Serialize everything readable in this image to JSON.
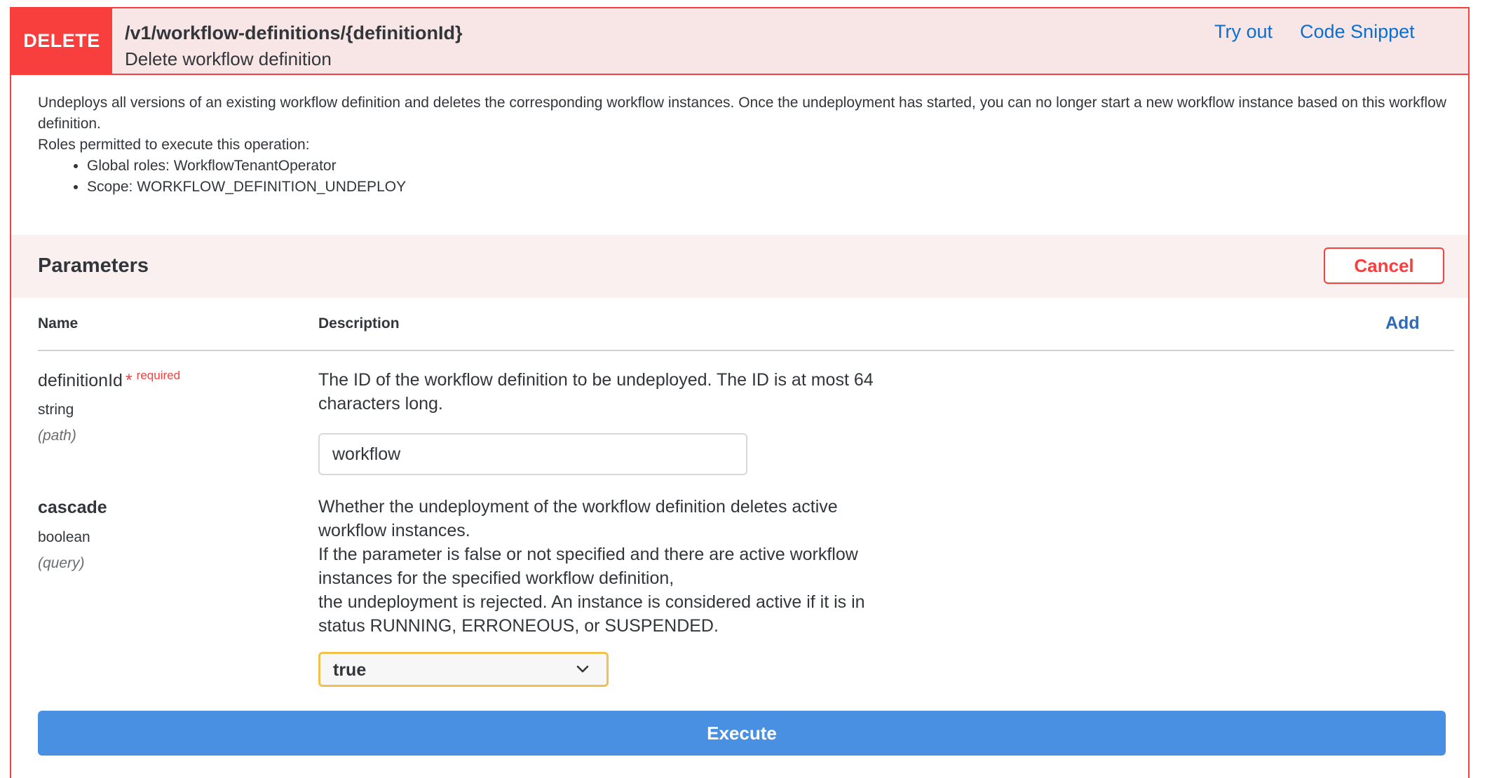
{
  "operation": {
    "method": "DELETE",
    "path": "/v1/workflow-definitions/{definitionId}",
    "summary": "Delete workflow definition",
    "links": {
      "try_out": "Try out",
      "code_snippet": "Code Snippet"
    },
    "description": "Undeploys all versions of an existing workflow definition and deletes the corresponding workflow instances. Once the undeployment has started, you can no longer start a new workflow instance based on this workflow definition.",
    "roles_heading": "Roles permitted to execute this operation:",
    "roles": [
      "Global roles: WorkflowTenantOperator",
      "Scope: WORKFLOW_DEFINITION_UNDEPLOY"
    ]
  },
  "parameters": {
    "title": "Parameters",
    "cancel_label": "Cancel",
    "columns": {
      "name": "Name",
      "description": "Description"
    },
    "add_label": "Add",
    "items": [
      {
        "name": "definitionId",
        "required_star": "*",
        "required_label": "required",
        "type": "string",
        "location": "(path)",
        "description": [
          "The ID of the workflow definition to be undeployed. The ID is at most 64 characters long."
        ],
        "input_value": "workflow"
      },
      {
        "name": "cascade",
        "type": "boolean",
        "location": "(query)",
        "description": [
          "Whether the undeployment of the workflow definition deletes active workflow instances.",
          "If the parameter is false or not specified and there are active workflow instances for the specified workflow definition,",
          "the undeployment is rejected. An instance is considered active if it is in status RUNNING, ERRONEOUS, or SUSPENDED."
        ],
        "selected_value": "true"
      }
    ]
  },
  "execute_label": "Execute",
  "colors": {
    "delete_accent": "#f93e3e",
    "header_bg": "#f8e6e6",
    "params_bg": "#fbf0f0",
    "link": "#0a6ed1",
    "execute": "#4990e2",
    "select_focus": "#f0c24b"
  },
  "icons": {
    "select_toggle": "chevron-down-icon"
  }
}
